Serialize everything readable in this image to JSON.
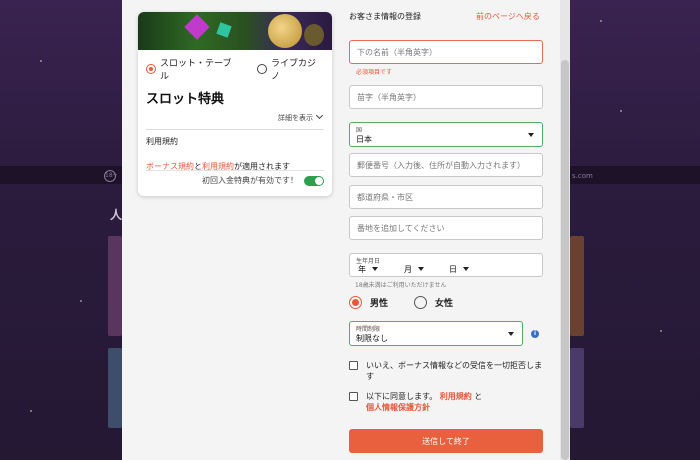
{
  "background": {
    "section_title": "人",
    "logo_text": "18+",
    "site_text": "s.com"
  },
  "bonus_card": {
    "game_options": [
      "スロット・テーブル",
      "ライブカジノ"
    ],
    "selected_option": "スロット・テーブル",
    "title": "スロット特典",
    "details_label": "詳細を表示",
    "terms_heading": "利用規約",
    "terms_text": {
      "part1": "ボーナス規約",
      "part2": "と",
      "part3": "利用規約",
      "part4": "が適用されます"
    },
    "first_deposit_label": "初回入金特典が有効です！",
    "first_deposit_enabled": true
  },
  "form": {
    "heading": "お客さま情報の登録",
    "back_link": "前のページへ戻る",
    "first_name_placeholder": "下の名前（半角英字）",
    "first_name_error": "必須項目です",
    "last_name_placeholder": "苗字（半角英字）",
    "country_label": "国",
    "country_value": "日本",
    "postal_placeholder": "郵便番号（入力後、住所が自動入力されます）",
    "prefecture_placeholder": "都道府県・市区",
    "address_placeholder": "番地を追加してください",
    "dob_label": "生年月日",
    "dob_year": "年",
    "dob_month": "月",
    "dob_day": "日",
    "dob_hint": "18歳未満はご利用いただけません",
    "gender_options": [
      "男性",
      "女性"
    ],
    "selected_gender": "男性",
    "time_limit_label": "時間制限",
    "time_limit_value": "制限なし",
    "opt_out_text": "いいえ、ボーナス情報などの受信を一切拒否します",
    "agree_prefix": "以下に同意します。",
    "agree_terms": "利用規約",
    "agree_and": "と",
    "agree_privacy": "個人情報保護方針",
    "submit_label": "送信して終了"
  },
  "colors": {
    "accent": "#e8583a",
    "success": "#2e9e4f",
    "info": "#3a6fc4"
  }
}
